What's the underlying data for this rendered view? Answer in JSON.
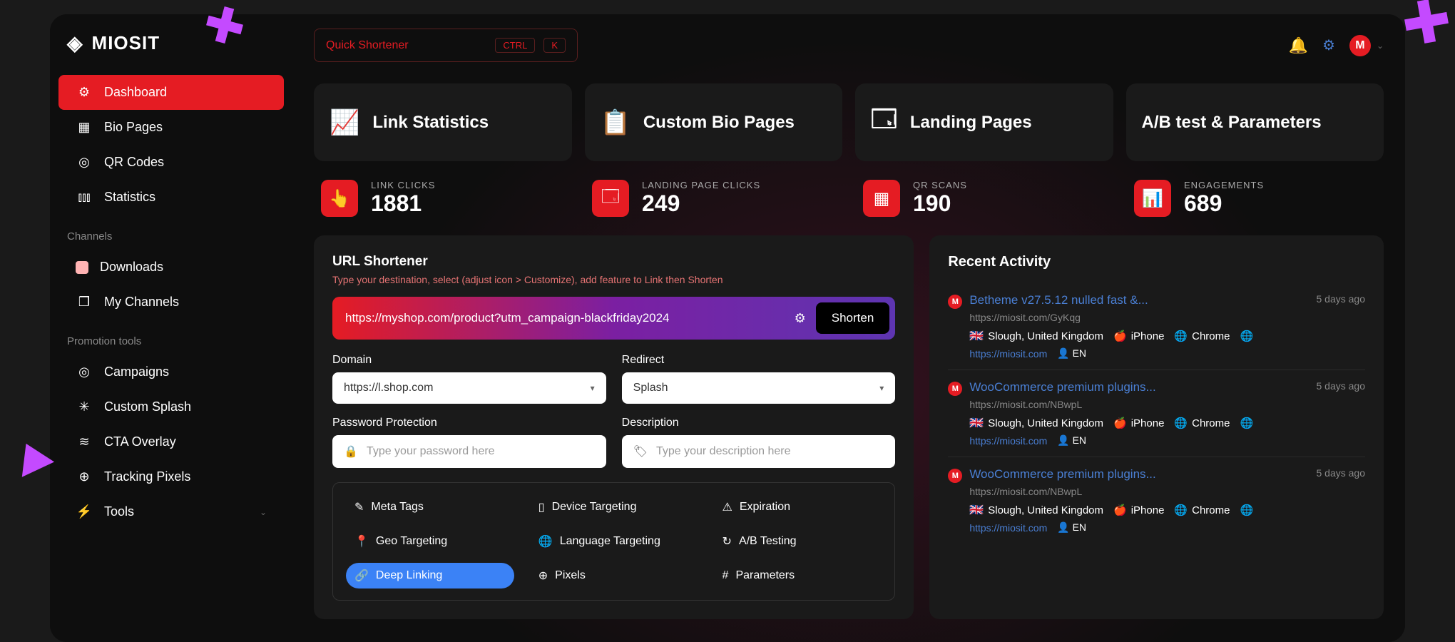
{
  "brand": "MIOSIT",
  "search": {
    "placeholder": "Quick Shortener",
    "kbd1": "CTRL",
    "kbd2": "K"
  },
  "avatar_letter": "M",
  "sidebar": {
    "main": [
      {
        "label": "Dashboard",
        "active": true
      },
      {
        "label": "Bio Pages"
      },
      {
        "label": "QR Codes"
      },
      {
        "label": "Statistics"
      }
    ],
    "sec1_title": "Channels",
    "sec1": [
      {
        "label": "Downloads"
      },
      {
        "label": "My Channels"
      }
    ],
    "sec2_title": "Promotion tools",
    "sec2": [
      {
        "label": "Campaigns"
      },
      {
        "label": "Custom Splash"
      },
      {
        "label": "CTA Overlay"
      },
      {
        "label": "Tracking Pixels"
      },
      {
        "label": "Tools"
      }
    ]
  },
  "tabs": [
    {
      "label": "Link Statistics"
    },
    {
      "label": "Custom Bio Pages"
    },
    {
      "label": "Landing Pages"
    },
    {
      "label": "A/B test & Parameters"
    }
  ],
  "stats": [
    {
      "label": "LINK CLICKS",
      "value": "1881"
    },
    {
      "label": "LANDING PAGE CLICKS",
      "value": "249"
    },
    {
      "label": "QR SCANS",
      "value": "190"
    },
    {
      "label": "ENGAGEMENTS",
      "value": "689"
    }
  ],
  "shortener": {
    "title": "URL Shortener",
    "subtitle": "Type your destination, select (adjust icon > Customize), add feature to Link then Shorten",
    "url": "https://myshop.com/product?utm_campaign-blackfriday2024",
    "shorten_btn": "Shorten",
    "domain_label": "Domain",
    "domain_value": "https://l.shop.com",
    "redirect_label": "Redirect",
    "redirect_value": "Splash",
    "pwd_label": "Password Protection",
    "pwd_placeholder": "Type your password here",
    "desc_label": "Description",
    "desc_placeholder": "Type your description here",
    "features": [
      "Meta Tags",
      "Device Targeting",
      "Expiration",
      "Geo Targeting",
      "Language Targeting",
      "A/B Testing",
      "Deep Linking",
      "Pixels",
      "Parameters"
    ]
  },
  "activity": {
    "title": "Recent Activity",
    "items": [
      {
        "title": "Betheme v27.5.12 nulled fast &...",
        "url": "https://miosit.com/GyKqg",
        "time": "5 days ago",
        "loc": "Slough, United Kingdom",
        "device": "iPhone",
        "browser": "Chrome",
        "link": "https://miosit.com",
        "lang": "EN"
      },
      {
        "title": "WooCommerce premium plugins...",
        "url": "https://miosit.com/NBwpL",
        "time": "5 days ago",
        "loc": "Slough, United Kingdom",
        "device": "iPhone",
        "browser": "Chrome",
        "link": "https://miosit.com",
        "lang": "EN"
      },
      {
        "title": "WooCommerce premium plugins...",
        "url": "https://miosit.com/NBwpL",
        "time": "5 days ago",
        "loc": "Slough, United Kingdom",
        "device": "iPhone",
        "browser": "Chrome",
        "link": "https://miosit.com",
        "lang": "EN"
      }
    ]
  }
}
